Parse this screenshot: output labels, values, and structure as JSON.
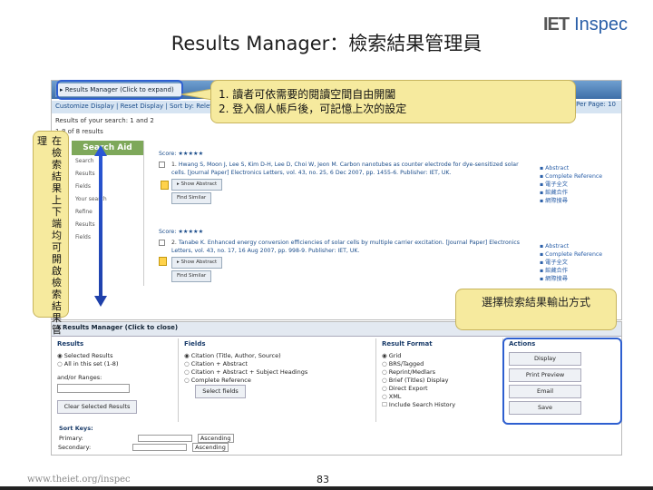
{
  "title": "Results Manager：檢索結果管理員",
  "logo": {
    "iet": "IET",
    "inspec": "Inspec"
  },
  "screenshot_top": {
    "rm_tab": "▸ Results Manager (Click to expand)",
    "nav_bar": "Customize Display | Reset Display | Sort by: Relevance to Least Relevant ...",
    "per_page": "Per Page: 10",
    "results_of": "Results of your search: 1 and 2",
    "range": "1-8 of 8 results",
    "search_aid": "Search Aid",
    "aid_lines": [
      "Search",
      "Results",
      "Fields",
      "Your search",
      "Refine",
      "Results",
      "Fields"
    ],
    "results": [
      {
        "score": "Score: ★★★★★",
        "num": "1.",
        "text": "Hwang S, Moon J, Lee S, Kim D-H, Lee D, Choi W, Jeon M. Carbon nanotubes as counter electrode for dye-sensitized solar cells. [Journal Paper] Electronics Letters, vol. 43, no. 25, 6 Dec 2007, pp. 1455-6. Publisher: IET, UK.",
        "btn_abstract": "▸ Show Abstract",
        "btn_similar": "Find Similar"
      },
      {
        "score": "Score: ★★★★★",
        "num": "2.",
        "text": "Tanabe K. Enhanced energy conversion efficiencies of solar cells by multiple carrier excitation. [Journal Paper] Electronics Letters, vol. 43, no. 17, 16 Aug 2007, pp. 998-9. Publisher: IET, UK.",
        "btn_abstract": "▸ Show Abstract",
        "btn_similar": "Find Similar"
      }
    ],
    "links": [
      "Abstract",
      "Complete Reference",
      "電子全文",
      "館藏合作",
      "網際搜尋"
    ]
  },
  "callout_top": {
    "line1": "1.  讀者可依需要的閱讀空間自由開闔",
    "line2": "2.  登入個人帳戶後，可記憶上次的設定"
  },
  "vertical_label": {
    "col1": "理",
    "col2": "在檢索結果上下端均可開啟檢索結果管"
  },
  "screenshot_bottom": {
    "rm_tab": "▾ Results Manager (Click to close)",
    "results": {
      "heading": "Results",
      "options": [
        "Selected Results",
        "All in this set (1-8)"
      ],
      "and_or": "and/or Ranges:",
      "clear_btn": "Clear Selected Results"
    },
    "fields": {
      "heading": "Fields",
      "options": [
        "Citation (Title, Author, Source)",
        "Citation + Abstract",
        "Citation + Abstract + Subject Headings",
        "Complete Reference"
      ],
      "select_btn": "Select fields"
    },
    "format": {
      "heading": "Result Format",
      "options": [
        "Grid",
        "BRS/Tagged",
        "Reprint/Medlars",
        "Brief (Titles) Display",
        "Direct Export",
        "XML"
      ],
      "include": "Include Search History"
    },
    "actions": {
      "heading": "Actions",
      "buttons": [
        "Display",
        "Print Preview",
        "Email",
        "Save"
      ]
    },
    "sort": {
      "heading": "Sort Keys:",
      "primary": "Primary:",
      "secondary": "Secondary:",
      "asc1": "Ascending",
      "asc2": "Ascending"
    }
  },
  "callout_actions": "選擇檢索結果輸出方式",
  "footer": {
    "url": "www.theiet.org/inspec",
    "page": "83"
  }
}
